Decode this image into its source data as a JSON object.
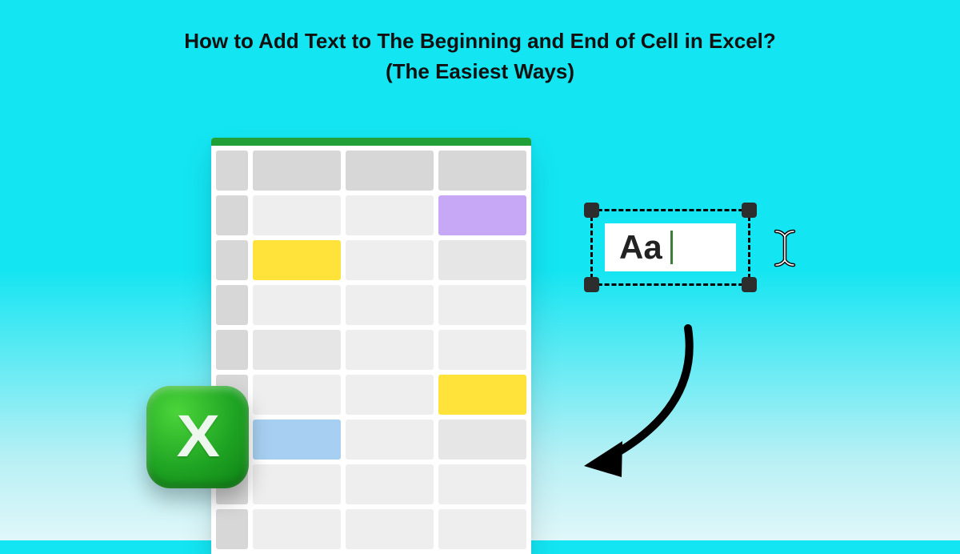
{
  "heading": {
    "line1": "How to Add Text to The Beginning and End of Cell in Excel?",
    "line2": "(The Easiest Ways)"
  },
  "textbox": {
    "sample_text": "Aa"
  },
  "excel": {
    "letter": "X"
  }
}
